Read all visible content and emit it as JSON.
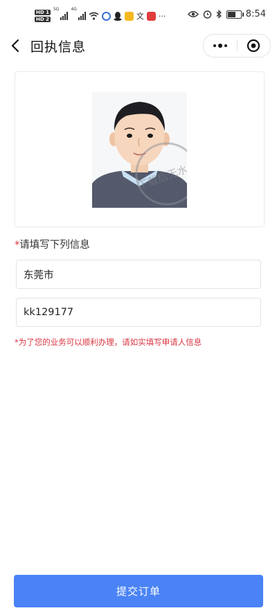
{
  "status_bar": {
    "hd_badge_1": "HD 1",
    "hd_badge_2": "HD 2",
    "net_1": "5G",
    "net_2": "4G",
    "icons": [
      "wifi-icon",
      "browser-icon",
      "qq-icon",
      "game-app-icon",
      "translate-icon",
      "red-app-icon",
      "more-dots"
    ],
    "right_icons": [
      "eye-icon",
      "alarm-icon",
      "bluetooth-icon",
      "battery-icon"
    ],
    "battery_level": 0.55,
    "time": "8:54"
  },
  "nav": {
    "title": "回执信息",
    "back_icon": "chevron-left-icon",
    "menu_icon": "more-icon",
    "close_icon": "target-icon"
  },
  "photo": {
    "description_icon": "child-id-photo",
    "watermark": "下载后无水印"
  },
  "form": {
    "required_mark": "*",
    "section_label": "请填写下列信息",
    "city_value": "东莞市",
    "code_value": "kk129177",
    "notice": "*为了您的业务可以顺利办理，请如实填写申请人信息"
  },
  "footer": {
    "submit_label": "提交订单"
  },
  "colors": {
    "accent": "#4a83f5",
    "required": "#d8343f"
  }
}
